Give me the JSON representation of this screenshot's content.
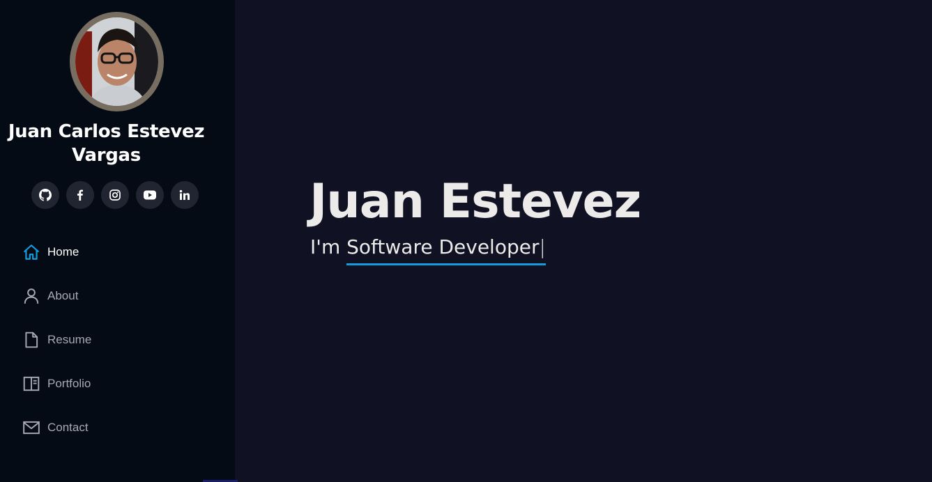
{
  "profile": {
    "name": "Juan Carlos Estevez Vargas"
  },
  "social": [
    {
      "icon": "github-icon"
    },
    {
      "icon": "facebook-icon"
    },
    {
      "icon": "instagram-icon"
    },
    {
      "icon": "youtube-icon"
    },
    {
      "icon": "linkedin-icon"
    }
  ],
  "nav": {
    "items": [
      {
        "label": "Home",
        "icon": "home-icon",
        "active": true
      },
      {
        "label": "About",
        "icon": "user-icon",
        "active": false
      },
      {
        "label": "Resume",
        "icon": "file-icon",
        "active": false
      },
      {
        "label": "Portfolio",
        "icon": "portfolio-icon",
        "active": false
      },
      {
        "label": "Contact",
        "icon": "envelope-icon",
        "active": false
      }
    ]
  },
  "hero": {
    "title": "Juan Estevez",
    "prefix": "I'm ",
    "typed": "Software Developer",
    "cursor": "|"
  },
  "colors": {
    "sidebar_bg": "#040b14",
    "main_bg": "#101224",
    "accent": "#149ddd",
    "text_primary": "#ecebea",
    "nav_text": "#a8a9b4"
  }
}
